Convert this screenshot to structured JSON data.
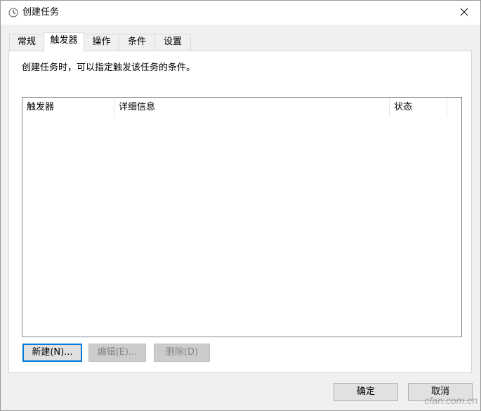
{
  "window": {
    "title": "创建任务"
  },
  "tabs": [
    {
      "label": "常规",
      "active": false
    },
    {
      "label": "触发器",
      "active": true
    },
    {
      "label": "操作",
      "active": false
    },
    {
      "label": "条件",
      "active": false
    },
    {
      "label": "设置",
      "active": false
    }
  ],
  "triggers_page": {
    "description": "创建任务时，可以指定触发该任务的条件。",
    "columns": [
      "触发器",
      "详细信息",
      "状态"
    ],
    "rows": [],
    "new_button": "新建(N)...",
    "edit_button": "编辑(E)...",
    "delete_button": "删除(D)"
  },
  "footer": {
    "ok_button": "确定",
    "cancel_button": "取消"
  },
  "watermark": "cfan.com.cn",
  "icons": {
    "title": "clock-icon",
    "close": "close-icon"
  },
  "colors": {
    "focus_border": "#0078d7",
    "disabled_text": "#838383"
  }
}
